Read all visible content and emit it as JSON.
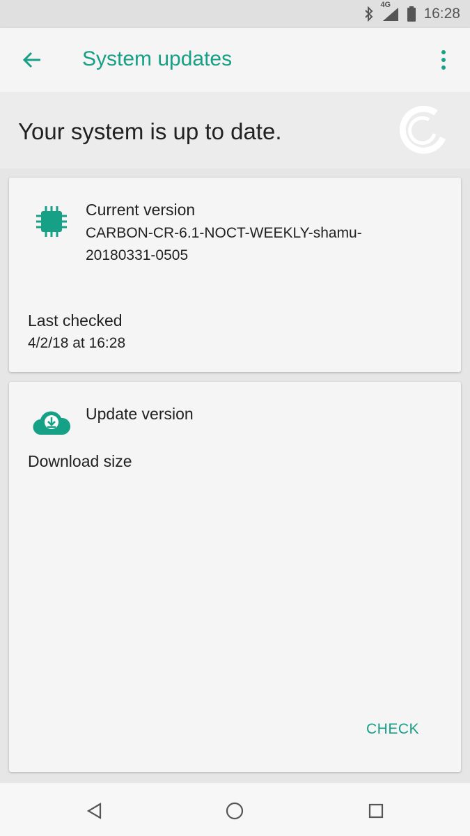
{
  "status_bar": {
    "time": "16:28",
    "network": "4G",
    "icons": [
      "bluetooth-icon",
      "signal-icon",
      "battery-icon"
    ]
  },
  "app_bar": {
    "title": "System updates",
    "back_icon": "arrow-back-icon",
    "menu_icon": "more-vert-icon"
  },
  "header": {
    "headline": "Your system is up to date."
  },
  "current_version": {
    "label": "Current version",
    "value_line1": "CARBON-CR-6.1-NOCT-WEEKLY-shamu-",
    "value_line2": "20180331-0505",
    "icon": "chip-icon"
  },
  "last_checked": {
    "label": "Last checked",
    "value": "4/2/18 at 16:28"
  },
  "update": {
    "label": "Update version",
    "download_label": "Download size",
    "icon": "cloud-download-icon",
    "check_label": "CHECK"
  },
  "colors": {
    "accent": "#16a086"
  }
}
